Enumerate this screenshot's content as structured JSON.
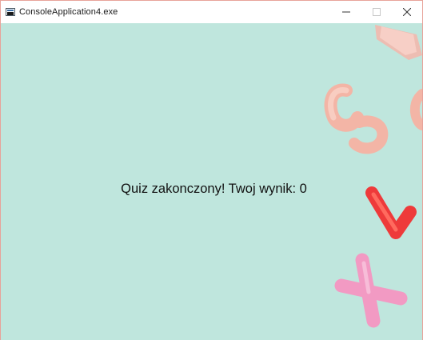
{
  "window": {
    "title": "ConsoleApplication4.exe",
    "controls": {
      "minimize_icon": "minimize-icon",
      "maximize_icon": "maximize-icon",
      "close_icon": "close-icon"
    }
  },
  "content": {
    "message": "Quiz zakonczony! Twoj wynik: 0",
    "background_color": "#bfe6dd"
  }
}
